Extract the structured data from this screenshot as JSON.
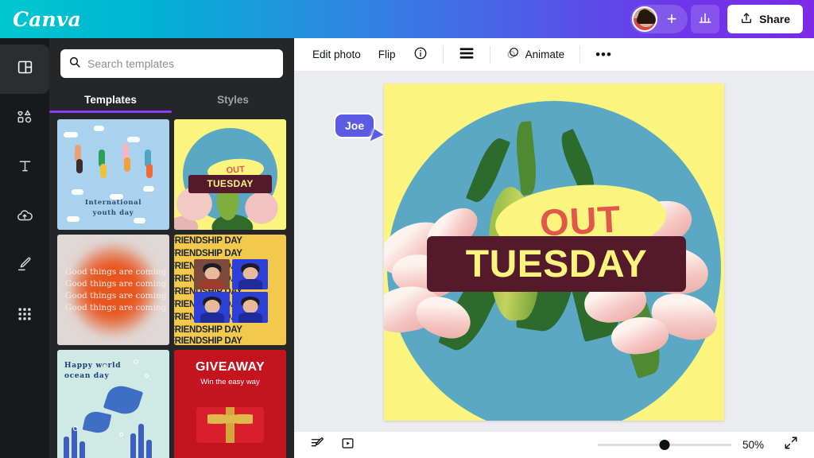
{
  "app": {
    "brand": "Canva",
    "brand_gradient_start": "#00c8cf",
    "brand_gradient_end": "#7d2ae8",
    "accent_purple": "#8b3dff"
  },
  "topbar": {
    "avatar_name": "avatar",
    "add_people_label": "+",
    "stats_icon": "bar-chart-icon",
    "share_label": "Share",
    "share_icon": "upload-icon"
  },
  "rail": {
    "items": [
      {
        "icon": "templates-panel-icon",
        "name": "templates",
        "active": true
      },
      {
        "icon": "elements-shapes-icon",
        "name": "elements",
        "active": false
      },
      {
        "icon": "text-icon",
        "name": "text",
        "active": false
      },
      {
        "icon": "upload-cloud-icon",
        "name": "uploads",
        "active": false
      },
      {
        "icon": "draw-pen-icon",
        "name": "draw",
        "active": false
      },
      {
        "icon": "apps-grid-icon",
        "name": "apps",
        "active": false
      }
    ]
  },
  "panel": {
    "search": {
      "placeholder": "Search templates",
      "value": "",
      "icon": "search-icon"
    },
    "tabs": [
      {
        "label": "Templates",
        "active": true
      },
      {
        "label": "Styles",
        "active": false
      }
    ],
    "templates": [
      {
        "id": "youth-day",
        "title": "International youth day",
        "line1": "International",
        "line2": "youth day"
      },
      {
        "id": "out-tuesday",
        "title": "Out Tuesday",
        "word1": "OUT",
        "word2": "TUESDAY"
      },
      {
        "id": "good-things",
        "title": "Good things are coming",
        "line": "Good things are coming"
      },
      {
        "id": "friendship-day",
        "title": "Friendship Day",
        "word": "FRIENDSHIP DAY"
      },
      {
        "id": "ocean-day",
        "title": "Happy World Ocean Day",
        "line1": "Happy world",
        "line2": "ocean day"
      },
      {
        "id": "giveaway",
        "title": "Giveaway",
        "line1": "GIVEAWAY",
        "line2": "Win the easy way"
      }
    ]
  },
  "toolbar": {
    "edit_photo_label": "Edit photo",
    "flip_label": "Flip",
    "info_icon": "info-circle-icon",
    "position_icon": "position-layers-icon",
    "animate_label": "Animate",
    "animate_icon": "animate-circles-icon",
    "more_label": "•••"
  },
  "canvas": {
    "background_color": "#fbf47e",
    "circle_color": "#5aa8c4",
    "out_text": "OUT",
    "out_text_color": "#e2574c",
    "out_bubble_color": "#fbf47e",
    "tuesday_text": "TUESDAY",
    "tuesday_text_color": "#fbf47e",
    "tuesday_bar_color": "#55192c",
    "collaborator": {
      "name": "Joe",
      "color": "#5b5ce2"
    }
  },
  "bottombar": {
    "notes_icon": "notes-edit-icon",
    "present_icon": "present-play-icon",
    "zoom_percent": "50%",
    "zoom_value": 50,
    "fullscreen_icon": "expand-fullscreen-icon"
  }
}
